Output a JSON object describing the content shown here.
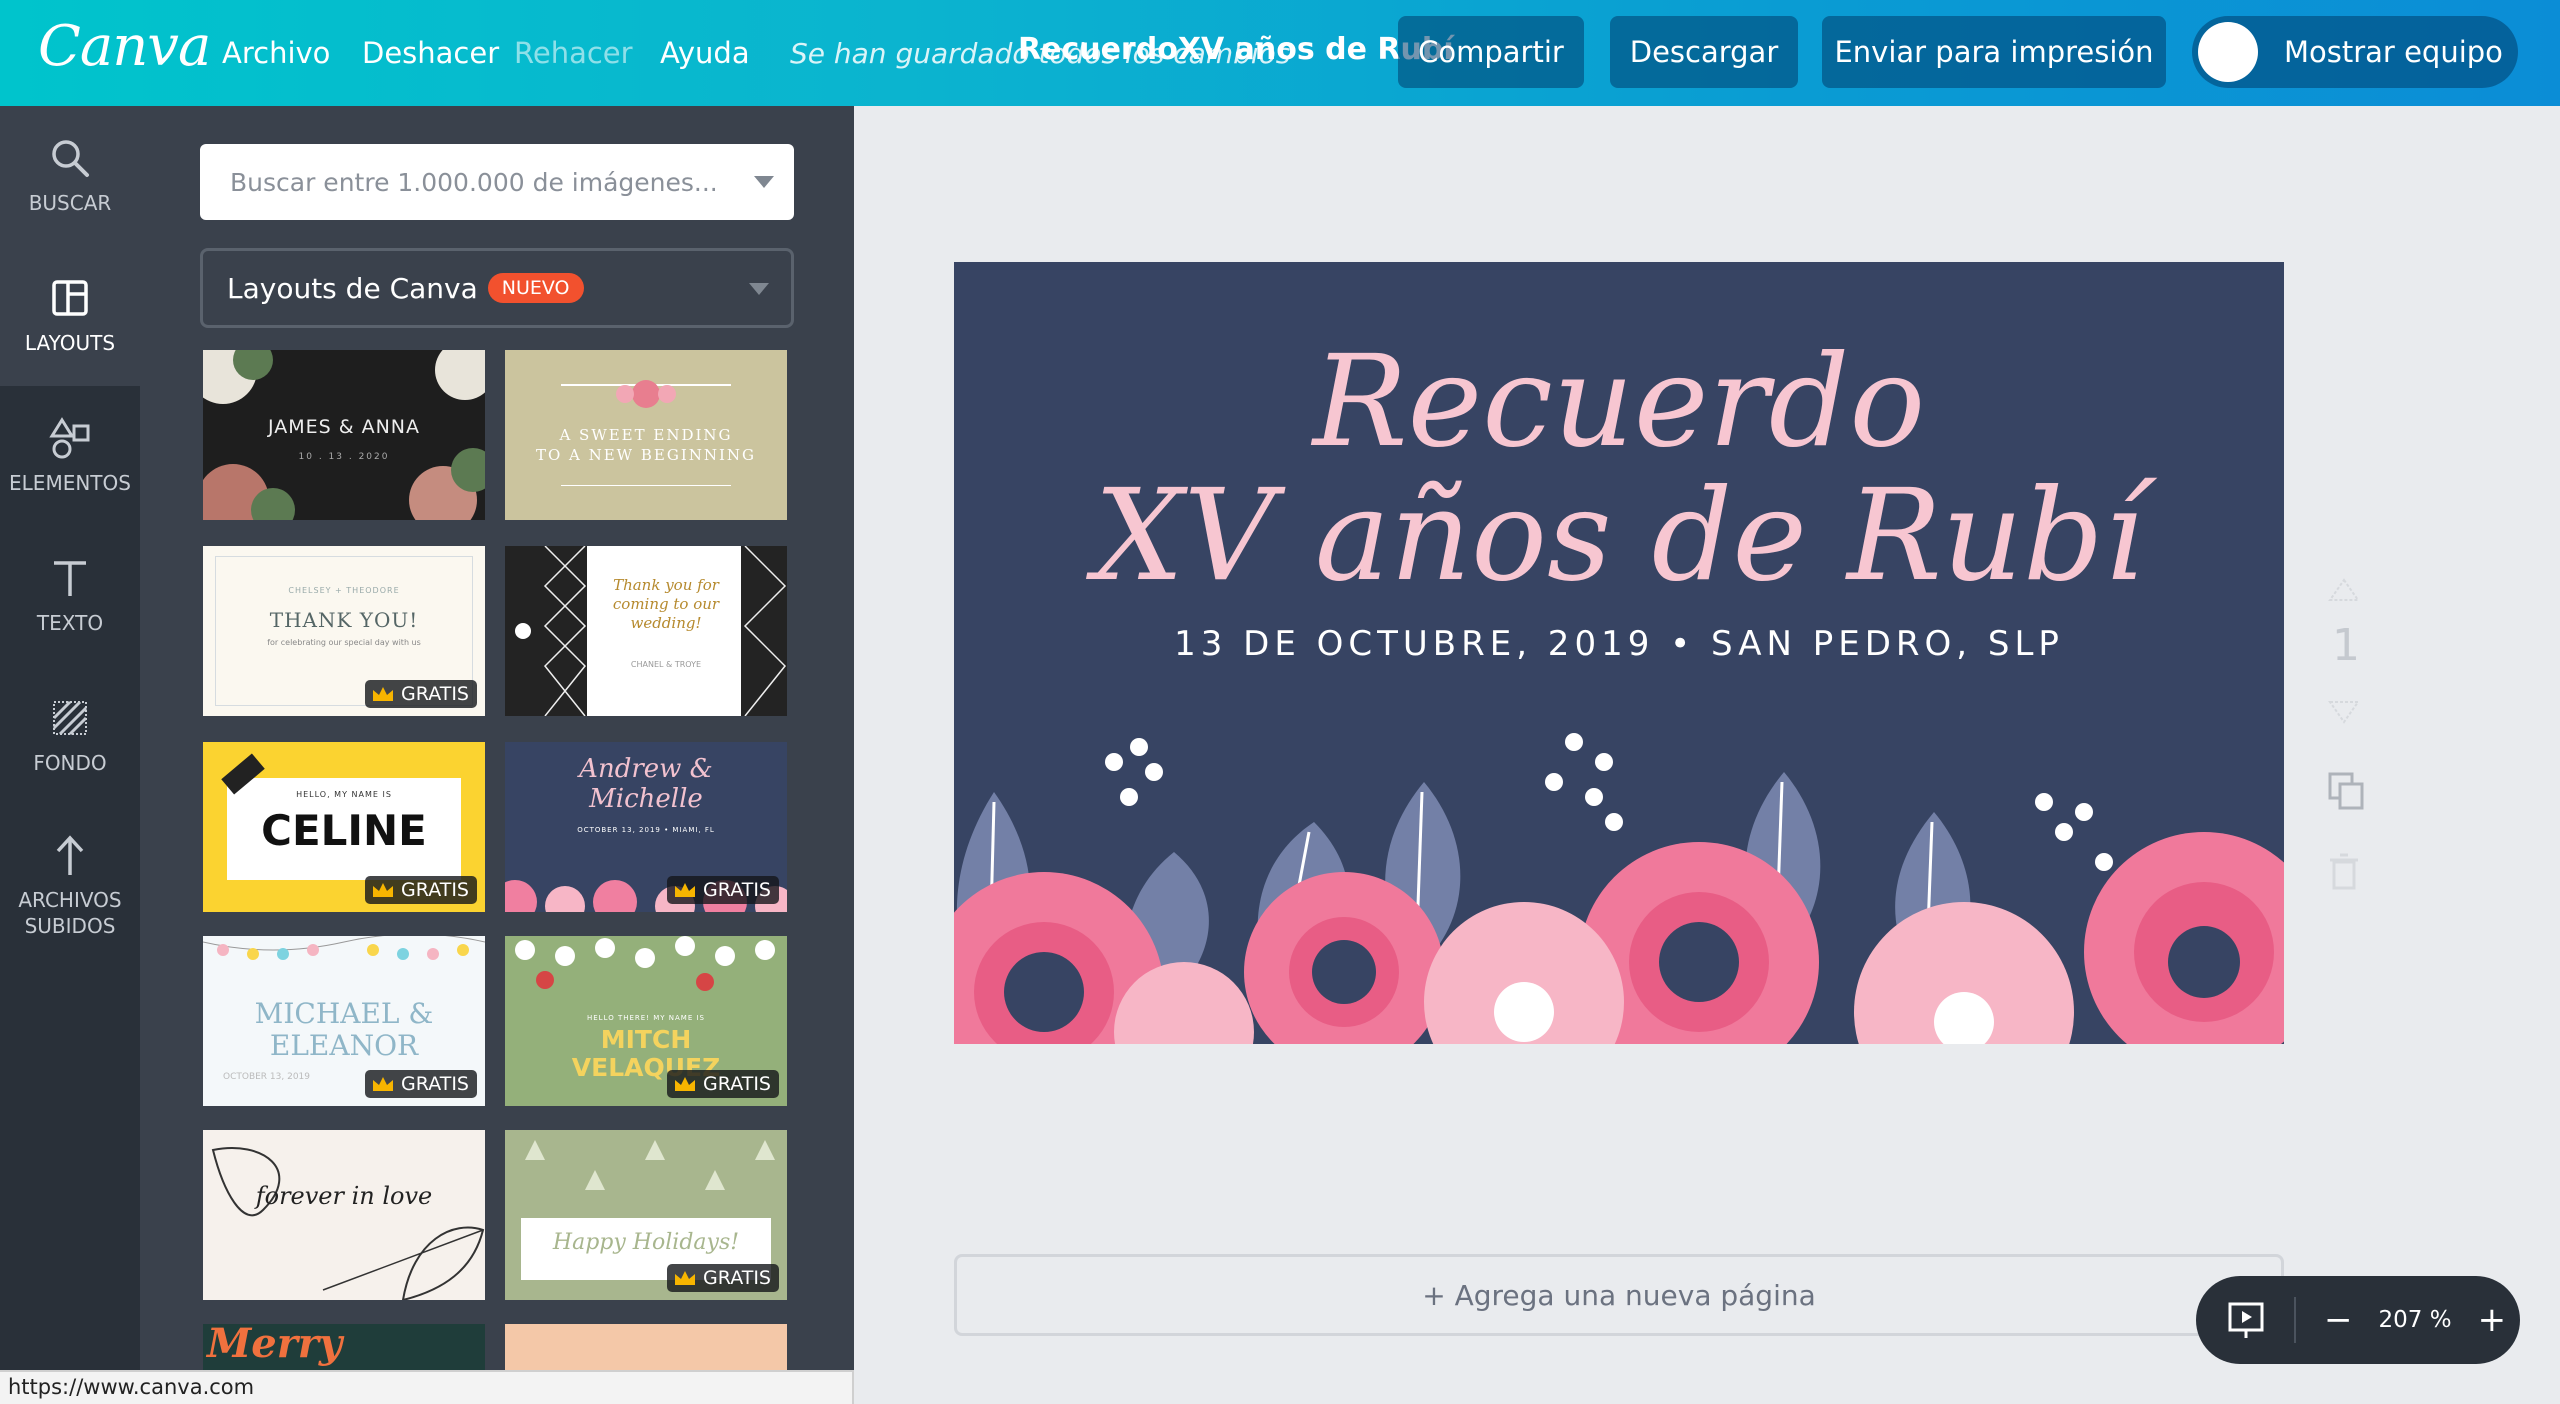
{
  "app": {
    "logo": "Canva"
  },
  "menu": {
    "file": "Archivo",
    "undo": "Deshacer",
    "redo": "Rehacer",
    "help": "Ayuda"
  },
  "header": {
    "saved_status": "Se han guardado todos los cambios",
    "doc_title": "RecuerdoXV años de Rubí",
    "share": "Compartir",
    "download": "Descargar",
    "print": "Enviar para impresión",
    "show_team": "Mostrar equipo"
  },
  "rail": {
    "items": [
      {
        "label": "BUSCAR",
        "icon": "search-icon"
      },
      {
        "label": "LAYOUTS",
        "icon": "layout-icon"
      },
      {
        "label": "ELEMENTOS",
        "icon": "shapes-icon"
      },
      {
        "label": "TEXTO",
        "icon": "text-icon"
      },
      {
        "label": "FONDO",
        "icon": "background-icon"
      },
      {
        "label": "ARCHIVOS SUBIDOS",
        "icon": "upload-icon"
      }
    ]
  },
  "panel": {
    "search_placeholder": "Buscar entre 1.000.000 de imágenes...",
    "layout_select": "Layouts de Canva",
    "new_badge": "NUEVO",
    "free_label": "GRATIS",
    "thumbs": {
      "t1_names": "JAMES & ANNA",
      "t1_date": "10 . 13 . 2020",
      "t2_line1": "A SWEET ENDING",
      "t2_line2": "TO A NEW BEGINNING",
      "t3_names": "CHELSEY + THEODORE",
      "t3_title": "THANK YOU!",
      "t3_body": "for celebrating our special day with us",
      "t4_text": "Thank you for coming to our wedding!",
      "t4_names": "CHANEL & TROYE",
      "t5_small": "HELLO, MY NAME IS",
      "t5_name": "CELINE",
      "t6_title": "Andrew & Michelle",
      "t6_sub": "OCTOBER 13, 2019 • MIAMI, FL",
      "t7_title": "MICHAEL & ELEANOR",
      "t7_sub": "OCTOBER 13, 2019",
      "t8_small": "HELLO THERE! MY NAME IS",
      "t8_name": "MITCH VELAQUEZ",
      "t9_text": "forever in love",
      "t10_text": "Happy Holidays!",
      "t11_text": "Merry"
    }
  },
  "design": {
    "title_line1": "Recuerdo",
    "title_line2": "XV años de Rubí",
    "subtitle": "13 DE OCTUBRE, 2019  •  SAN PEDRO, SLP",
    "bg_color": "#374463",
    "title_color": "#f7c6d1"
  },
  "page_controls": {
    "page_number": "1"
  },
  "add_page": "+ Agrega una nueva página",
  "zoom": {
    "value": "207 %",
    "minus": "−",
    "plus": "+"
  },
  "status_url": "https://www.canva.com",
  "colors": {
    "accent": "#00c4cc",
    "rail_bg": "#293039",
    "panel_bg": "#3a414c",
    "badge": "#f2512e"
  }
}
